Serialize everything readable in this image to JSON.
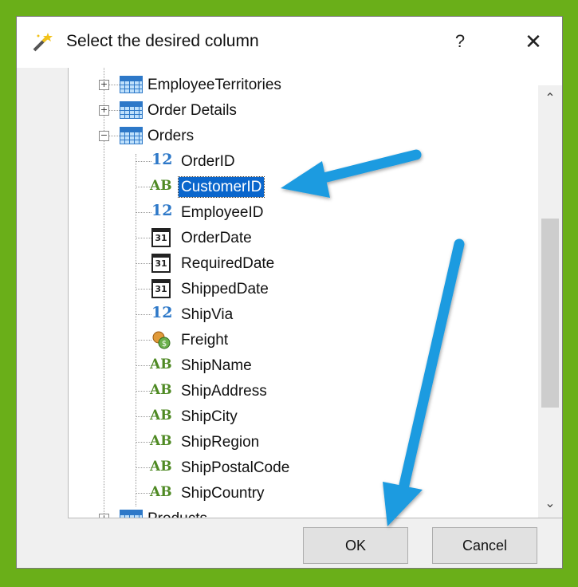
{
  "dialog": {
    "title": "Select the desired column",
    "help": "?",
    "close": "✕"
  },
  "tree": {
    "tables": [
      {
        "name": "EmployeeTerritories",
        "expander": "+"
      },
      {
        "name": "Order Details",
        "expander": "+"
      },
      {
        "name": "Orders",
        "expander": "−"
      }
    ],
    "columns": [
      {
        "name": "OrderID",
        "type": "number",
        "type_label": "12"
      },
      {
        "name": "CustomerID",
        "type": "text",
        "type_label": "AB",
        "selected": true
      },
      {
        "name": "EmployeeID",
        "type": "number",
        "type_label": "12"
      },
      {
        "name": "OrderDate",
        "type": "date",
        "type_label": "31"
      },
      {
        "name": "RequiredDate",
        "type": "date",
        "type_label": "31"
      },
      {
        "name": "ShippedDate",
        "type": "date",
        "type_label": "31"
      },
      {
        "name": "ShipVia",
        "type": "number",
        "type_label": "12"
      },
      {
        "name": "Freight",
        "type": "money",
        "type_label": ""
      },
      {
        "name": "ShipName",
        "type": "text",
        "type_label": "AB"
      },
      {
        "name": "ShipAddress",
        "type": "text",
        "type_label": "AB"
      },
      {
        "name": "ShipCity",
        "type": "text",
        "type_label": "AB"
      },
      {
        "name": "ShipRegion",
        "type": "text",
        "type_label": "AB"
      },
      {
        "name": "ShipPostalCode",
        "type": "text",
        "type_label": "AB"
      },
      {
        "name": "ShipCountry",
        "type": "text",
        "type_label": "AB"
      }
    ],
    "next_table": {
      "name": "Products",
      "expander": "+"
    }
  },
  "scrollbar": {
    "up_icon": "⌃",
    "down_icon": "⌄",
    "thumb_start_fraction": 0.28,
    "thumb_end_fraction": 0.78
  },
  "buttons": {
    "ok": "OK",
    "cancel": "Cancel"
  },
  "colors": {
    "background": "#6aaf19",
    "selection": "#0a66cc",
    "annotation_arrow": "#1e9be0"
  }
}
